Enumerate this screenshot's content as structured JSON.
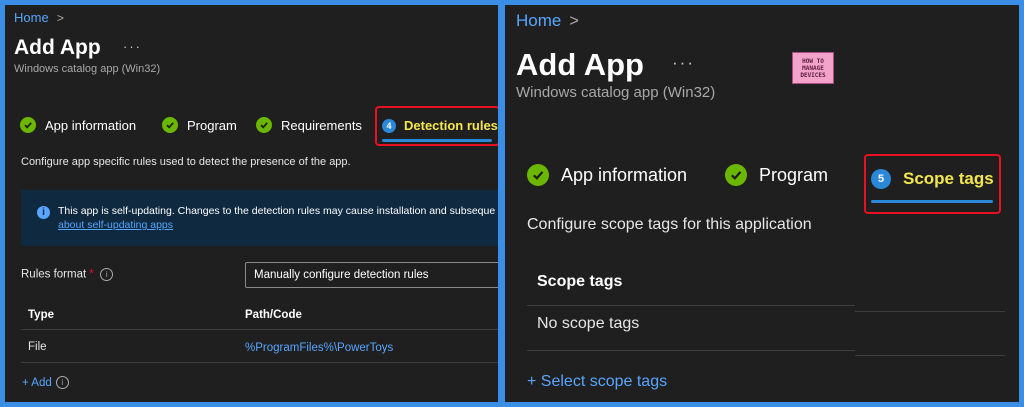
{
  "left": {
    "breadcrumb": "Home",
    "title": "Add App",
    "menu": "···",
    "subtitle": "Windows catalog app (Win32)",
    "steps": [
      {
        "label": "App information",
        "status": "done"
      },
      {
        "label": "Program",
        "status": "done"
      },
      {
        "label": "Requirements",
        "status": "done"
      },
      {
        "label": "Detection rules",
        "status": "active",
        "number": "4"
      }
    ],
    "description": "Configure app specific rules used to detect the presence of the app.",
    "info": {
      "text": "This app is self-updating. Changes to the detection rules may cause installation and subseque",
      "link": "about self-updating apps"
    },
    "rules_format": {
      "label": "Rules format",
      "required": "*",
      "value": "Manually configure detection rules"
    },
    "table": {
      "headers": [
        "Type",
        "Path/Code"
      ],
      "rows": [
        [
          "File",
          "%ProgramFiles%\\PowerToys"
        ]
      ]
    },
    "add_label": "+ Add"
  },
  "right": {
    "breadcrumb": "Home",
    "title": "Add App",
    "menu": "···",
    "subtitle": "Windows catalog app (Win32)",
    "logo_lines": [
      "HOW TO",
      "MANAGE",
      "DEVICES"
    ],
    "steps": [
      {
        "label": "App information",
        "status": "done"
      },
      {
        "label": "Program",
        "status": "done"
      },
      {
        "label": "Scope tags",
        "status": "active",
        "number": "5"
      }
    ],
    "description": "Configure scope tags for this application",
    "table": {
      "header": "Scope tags",
      "empty": "No scope tags"
    },
    "select_link": "+ Select scope tags"
  },
  "colors": {
    "background": "#1f1f1f",
    "frame": "#3a8ee6",
    "link": "#58a6ff",
    "check": "#6bb700",
    "active_label": "#f3e64e",
    "highlight": "#e81123"
  }
}
